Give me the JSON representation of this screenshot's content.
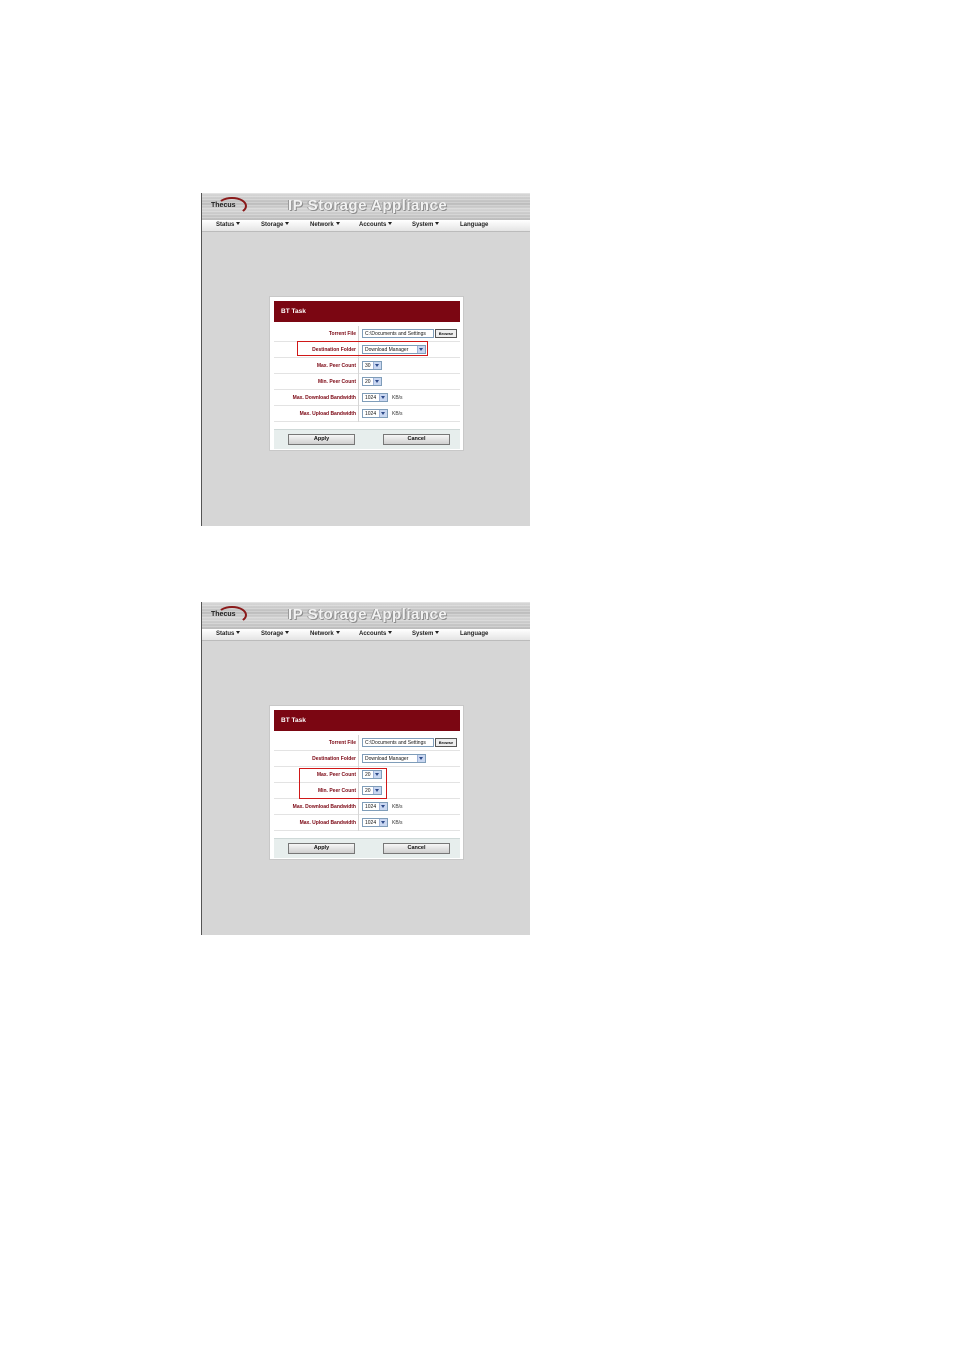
{
  "screenshots": [
    {
      "app_title": "IP Storage Appliance",
      "logo_text": "Thecus",
      "menu": [
        "Status",
        "Storage",
        "Network",
        "Accounts",
        "System",
        "Language"
      ],
      "dialog": {
        "title": "BT Task",
        "torrent_file_label": "Torrent File",
        "torrent_file_value": "C:\\Documents and Settings",
        "browse_label": "Browse",
        "destination_label": "Destination Folder",
        "destination_value": "Download Manager",
        "max_peer_label": "Max. Peer Count",
        "max_peer_value": "30",
        "min_peer_label": "Min. Peer Count",
        "min_peer_value": "20",
        "max_download_label": "Max. Download Bandwidth",
        "max_download_value": "1024",
        "max_upload_label": "Max. Upload Bandwidth",
        "max_upload_value": "1024",
        "unit": "KB/s",
        "apply_label": "Apply",
        "cancel_label": "Cancel"
      },
      "highlight": "Destination Folder"
    },
    {
      "app_title": "IP Storage Appliance",
      "logo_text": "Thecus",
      "menu": [
        "Status",
        "Storage",
        "Network",
        "Accounts",
        "System",
        "Language"
      ],
      "dialog": {
        "title": "BT Task",
        "torrent_file_label": "Torrent File",
        "torrent_file_value": "C:\\Documents and Settings",
        "browse_label": "Browse",
        "destination_label": "Destination Folder",
        "destination_value": "Download Manager",
        "max_peer_label": "Max. Peer Count",
        "max_peer_value": "20",
        "min_peer_label": "Min. Peer Count",
        "min_peer_value": "20",
        "max_download_label": "Max. Download Bandwidth",
        "max_download_value": "1024",
        "max_upload_label": "Max. Upload Bandwidth",
        "max_upload_value": "1024",
        "unit": "KB/s",
        "apply_label": "Apply",
        "cancel_label": "Cancel"
      },
      "highlight": "Max. Peer Count / Min. Peer Count"
    }
  ],
  "colors": {
    "brand": "#7b0612",
    "highlight": "#d01818",
    "background": "#d6d6d6"
  }
}
